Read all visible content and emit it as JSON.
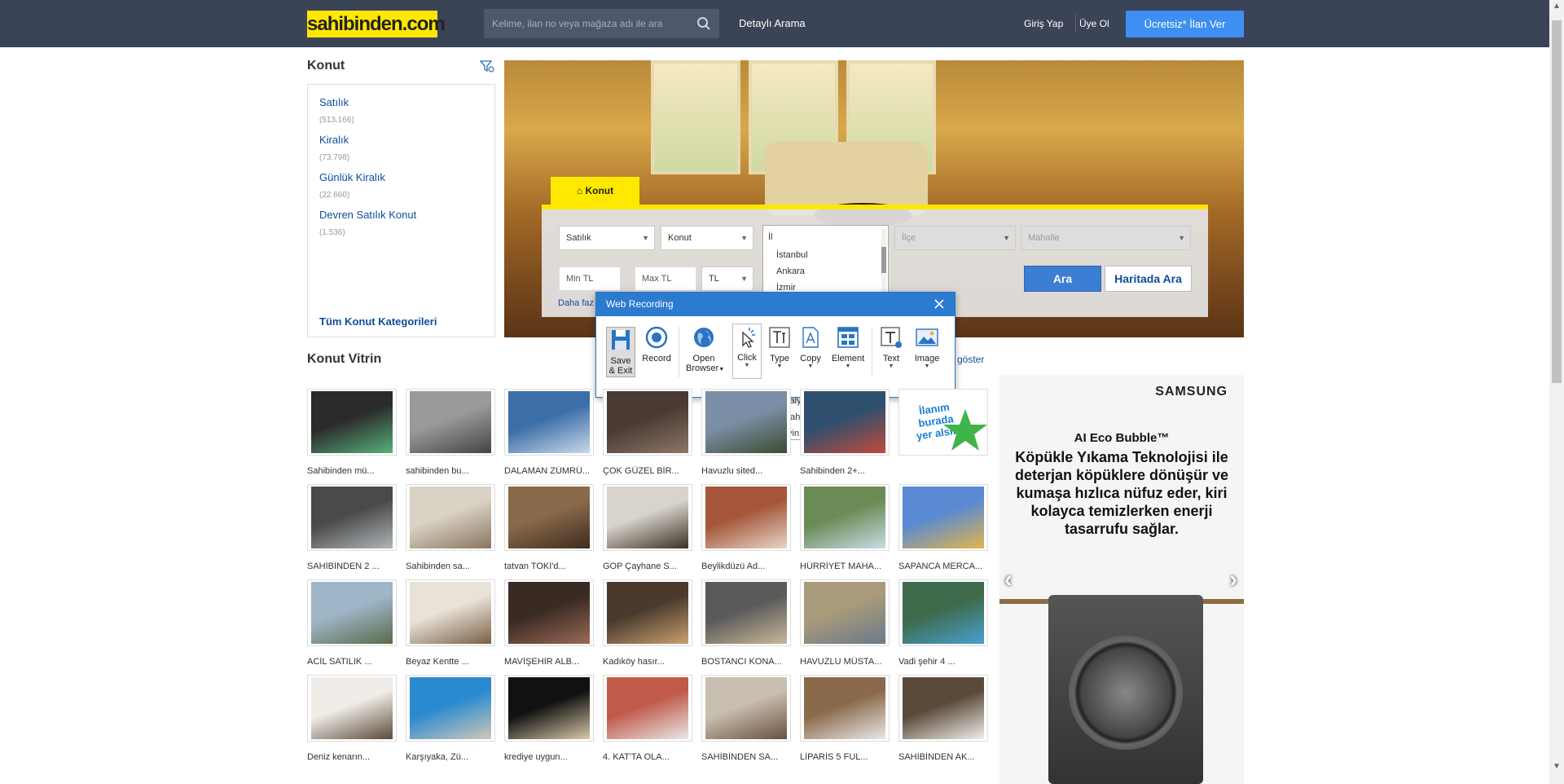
{
  "header": {
    "logo": "sahibinden.com",
    "search_placeholder": "Kelime, ilan no veya mağaza adı ile ara",
    "detailed_search": "Detaylı Arama",
    "login": "Giriş Yap",
    "register": "Üye Ol",
    "post_ad": "Ücretsiz* İlan Ver"
  },
  "sidebar": {
    "title": "Konut",
    "items": [
      {
        "label": "Satılık",
        "count": "(513.166)"
      },
      {
        "label": "Kiralık",
        "count": "(73.798)"
      },
      {
        "label": "Günlük Kiralık",
        "count": "(22.660)"
      },
      {
        "label": "Devren Satılık Konut",
        "count": "(1.536)"
      }
    ],
    "all_categories": "Tüm Konut Kategorileri"
  },
  "search_form": {
    "tab": "Konut",
    "type": "Satılık",
    "category": "Konut",
    "city_filter": "İl",
    "district": "İlçe",
    "neighborhood": "Mahalle",
    "min_price": "Min TL",
    "max_price": "Max TL",
    "currency": "TL",
    "search_button": "Ara",
    "map_button": "Haritada Ara",
    "more_link": "Daha faz",
    "cities_top": [
      "İstanbul",
      "Ankara",
      "İzmir"
    ],
    "cities_bottom": [
      "Antalya",
      "Ardahan",
      "Artvin"
    ]
  },
  "recorder": {
    "title": "Web Recording",
    "tools": {
      "save": "Save",
      "save2": "& Exit",
      "record": "Record",
      "open": "Open",
      "browser": "Browser",
      "click": "Click",
      "type": "Type",
      "copy": "Copy",
      "element": "Element",
      "text": "Text",
      "image": "Image"
    }
  },
  "vitrin": {
    "title": "Konut Vitrin",
    "show_all": "göster",
    "ad_text_1": "İlanım",
    "ad_text_2": "burada",
    "ad_text_3": "yer alsın",
    "rows": [
      [
        "Sahibinden mü...",
        "sahibinden bu...",
        "DALAMAN ZÜMRÜ...",
        "ÇOK GÜZEL BİR...",
        "Havuzlu sited...",
        "Sahibinden 2+..."
      ],
      [
        "SAHİBİNDEN 2 ...",
        "Sahibinden sa...",
        "tatvan TOKİ'd...",
        "GOP Çayhane S...",
        "Beylikdüzü Ad...",
        "HÜRRİYET MAHA...",
        "SAPANCA MERCA..."
      ],
      [
        "ACİL SATILIK ...",
        "Beyaz Kentte ...",
        "MAVİŞEHİR ALB...",
        "Kadıköy hasır...",
        "BOSTANCI KONA...",
        "HAVUZLU MÜSTA...",
        "Vadi şehir 4 ..."
      ],
      [
        "Deniz kenarın...",
        "Karşıyaka, Zü...",
        "krediye uygun...",
        "4. KAT'TA OLA...",
        "SAHİBİNDEN SA...",
        "LİPARİS 5 FUL...",
        "SAHİBİNDEN AK..."
      ]
    ]
  },
  "advert": {
    "brand": "SAMSUNG",
    "title": "AI Eco Bubble™",
    "text": "Köpükle Yıkama Teknolojisi ile deterjan köpüklere dönüşür ve kumaşa hızlıca nüfuz eder, kiri kolayca temizlerken enerji tasarrufu sağlar."
  },
  "colors": {
    "header_bg": "#3b4457",
    "logo_bg": "#ffe800",
    "accent": "#3e8ff1",
    "link": "#0e4d9d"
  }
}
